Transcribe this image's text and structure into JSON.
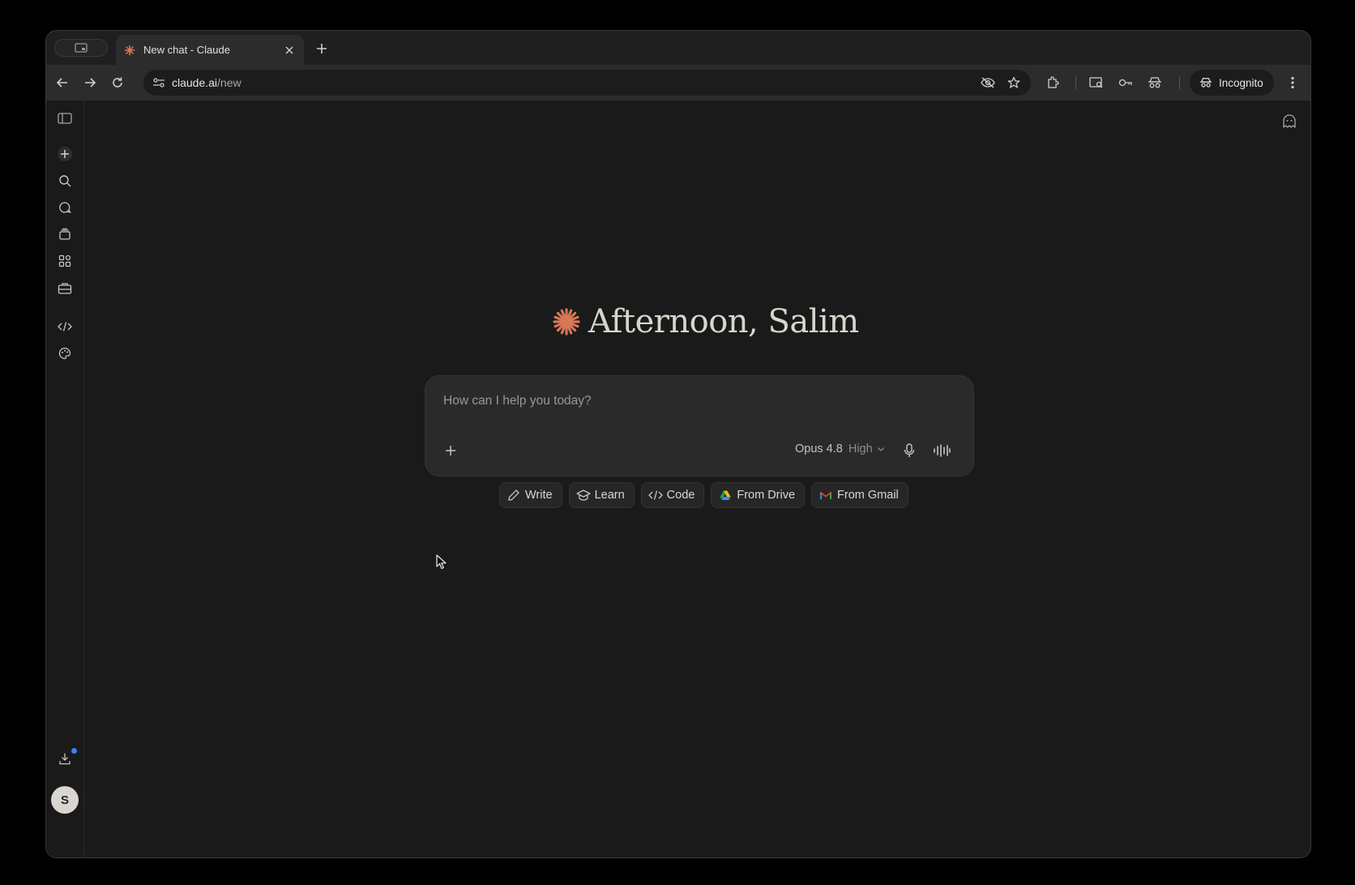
{
  "browser": {
    "tab": {
      "title": "New chat - Claude",
      "favicon": "claude-asterisk-icon"
    },
    "url": {
      "host": "claude.ai",
      "path": "/new"
    },
    "incognito_label": "Incognito"
  },
  "main": {
    "greeting": "Afternoon, Salim",
    "composer": {
      "placeholder": "How can I help you today?",
      "model": "Opus 4.8",
      "effort": "High"
    },
    "chips": [
      {
        "label": "Write",
        "icon": "pencil-icon"
      },
      {
        "label": "Learn",
        "icon": "graduation-cap-icon"
      },
      {
        "label": "Code",
        "icon": "code-icon"
      },
      {
        "label": "From Drive",
        "icon": "google-drive-icon"
      },
      {
        "label": "From Gmail",
        "icon": "gmail-icon"
      }
    ]
  },
  "user": {
    "initial": "S"
  },
  "colors": {
    "accent": "#d97757",
    "badge": "#3b82f6"
  }
}
